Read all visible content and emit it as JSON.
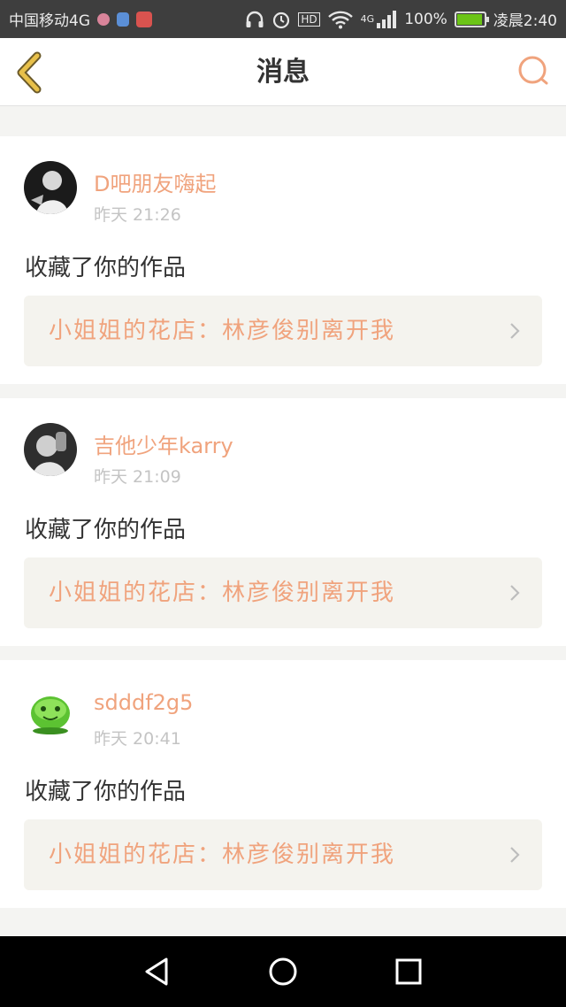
{
  "status_bar": {
    "carrier": "中国移动4G",
    "battery_percent": "100%",
    "time": "凌晨2:40",
    "hd_label": "HD",
    "network_label": "4G",
    "battery_level": 1.0,
    "battery_color": "#6cc417"
  },
  "header": {
    "title": "消息",
    "back_icon": "chevron-left-icon",
    "search_icon": "search-icon"
  },
  "colors": {
    "accent": "#f0a37d",
    "back_arrow": "#e8c04a",
    "card_bg": "#ffffff",
    "link_bg": "#f4f3ee"
  },
  "messages": [
    {
      "username": "D吧朋友嗨起",
      "time": "昨天 21:26",
      "action": "收藏了你的作品",
      "work_title": "小姐姐的花店：林彦俊别离开我"
    },
    {
      "username": "吉他少年karry",
      "time": "昨天 21:09",
      "action": "收藏了你的作品",
      "work_title": "小姐姐的花店：林彦俊别离开我"
    },
    {
      "username": "sdddf2g5",
      "time": "昨天 20:41",
      "action": "收藏了你的作品",
      "work_title": "小姐姐的花店：林彦俊别离开我"
    }
  ],
  "nav_bar": {
    "back_icon": "triangle-back-icon",
    "home_icon": "circle-home-icon",
    "recents_icon": "square-recents-icon"
  }
}
